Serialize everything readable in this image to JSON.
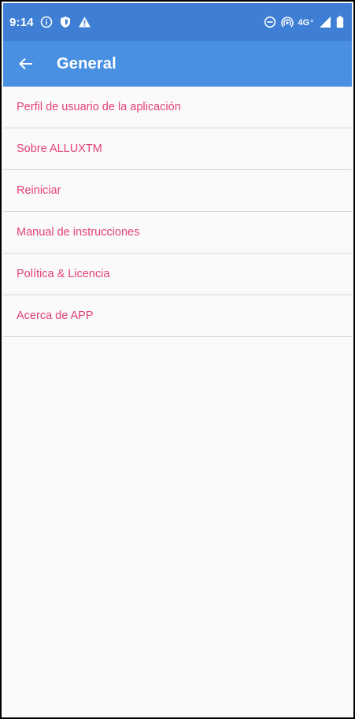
{
  "status_bar": {
    "time": "9:14",
    "network": "4G⁺",
    "left_icons": [
      "info-icon",
      "shield-icon",
      "warning-icon"
    ],
    "right_icons": [
      "do-not-disturb-icon",
      "hotspot-icon",
      "signal-icon",
      "battery-icon"
    ]
  },
  "app_bar": {
    "title": "General",
    "back_icon": "arrow-back-icon"
  },
  "menu": {
    "items": [
      {
        "label": "Perfil de usuario de la aplicación"
      },
      {
        "label": "Sobre ALLUXTM"
      },
      {
        "label": "Reiniciar"
      },
      {
        "label": "Manual de instrucciones"
      },
      {
        "label": "Política & Licencia"
      },
      {
        "label": "Acerca de APP"
      }
    ]
  },
  "colors": {
    "status_bar": "#3e7fd5",
    "app_bar": "#4a90e2",
    "menu_text": "#e3407a",
    "divider": "#d7d7d7",
    "background": "#fafafa"
  }
}
